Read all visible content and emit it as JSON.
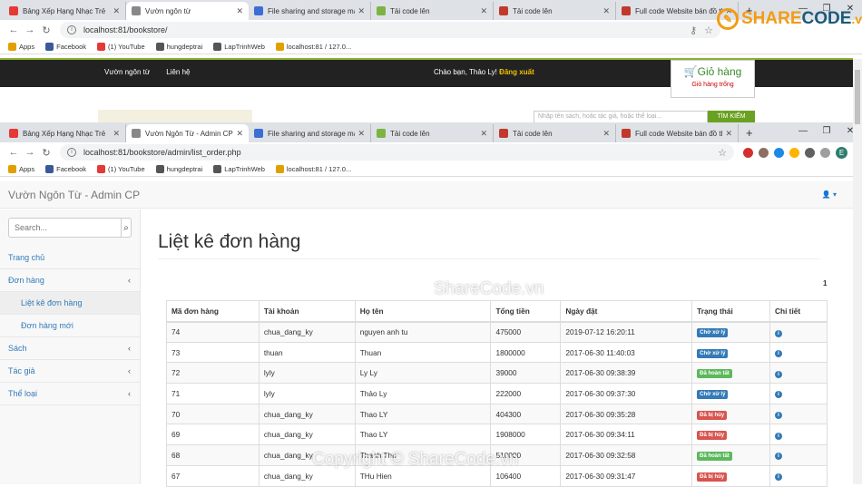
{
  "top_browser": {
    "tabs": [
      {
        "title": "Bảng Xếp Hạng Nhạc Trẻ",
        "color": "#e53935",
        "active": false
      },
      {
        "title": "Vườn ngôn từ",
        "color": "#888888",
        "active": true
      },
      {
        "title": "File sharing and storage made",
        "color": "#3b6fd6",
        "active": false
      },
      {
        "title": "Tải code lên",
        "color": "#7cb342",
        "active": false
      },
      {
        "title": "Tải code lên",
        "color": "#c0392b",
        "active": false
      },
      {
        "title": "Full code Website bán đồ thể",
        "color": "#c0392b",
        "active": false
      }
    ],
    "url": "localhost:81/bookstore/"
  },
  "bookmarks": [
    {
      "label": "Apps",
      "color": "#e0a000"
    },
    {
      "label": "Facebook",
      "color": "#3b5998"
    },
    {
      "label": "(1) YouTube",
      "color": "#e53935"
    },
    {
      "label": "hungdeptrai",
      "color": "#555555"
    },
    {
      "label": "LapTrinhWeb",
      "color": "#555555"
    },
    {
      "label": "localhost:81 / 127.0...",
      "color": "#e0a000"
    }
  ],
  "bg_site": {
    "menu": [
      "Vườn ngôn từ",
      "Liên hệ"
    ],
    "greeting": "Chào bạn, Thảo Ly!",
    "logout": "Đăng xuất",
    "cart_title": "Giỏ hàng",
    "cart_status": "Giỏ hàng trống",
    "search_placeholder": "Nhập tên sách, hoặc tác giả, hoặc thể loại...",
    "search_button": "TÌM KIẾM"
  },
  "watermark": {
    "logo_a": "SHARE",
    "logo_b": "CODE",
    "logo_c": ".vn",
    "center": "ShareCode.vn",
    "bottom": "Copyright © ShareCode.vn"
  },
  "second_browser": {
    "tabs": [
      {
        "title": "Bảng Xếp Hạng Nhạc Trẻ",
        "color": "#e53935",
        "active": false
      },
      {
        "title": "Vườn Ngôn Từ - Admin CP",
        "color": "#888888",
        "active": true
      },
      {
        "title": "File sharing and storage made",
        "color": "#3b6fd6",
        "active": false
      },
      {
        "title": "Tải code lên",
        "color": "#7cb342",
        "active": false
      },
      {
        "title": "Tải code lên",
        "color": "#c0392b",
        "active": false
      },
      {
        "title": "Full code Website bán đồ thể",
        "color": "#c0392b",
        "active": false
      }
    ],
    "url": "localhost:81/bookstore/admin/list_order.php"
  },
  "admin": {
    "brand": "Vườn Ngôn Từ - Admin CP",
    "search_placeholder": "Search...",
    "sidebar": [
      {
        "label": "Trang chủ",
        "sub": false,
        "arrow": false,
        "selected": false
      },
      {
        "label": "Đơn hàng",
        "sub": false,
        "arrow": true,
        "selected": false
      },
      {
        "label": "Liệt kê đơn hàng",
        "sub": true,
        "arrow": false,
        "selected": true
      },
      {
        "label": "Đơn hàng mới",
        "sub": true,
        "arrow": false,
        "selected": false
      },
      {
        "label": "Sách",
        "sub": false,
        "arrow": true,
        "selected": false
      },
      {
        "label": "Tác giả",
        "sub": false,
        "arrow": true,
        "selected": false
      },
      {
        "label": "Thể loại",
        "sub": false,
        "arrow": true,
        "selected": false
      }
    ],
    "page_title": "Liệt kê đơn hàng",
    "page_number": "1",
    "columns": [
      "Mã đơn hàng",
      "Tài khoản",
      "Họ tên",
      "Tổng tiền",
      "Ngày đặt",
      "Trạng thái",
      "Chi tiết"
    ],
    "rows": [
      {
        "id": "74",
        "account": "chua_dang_ky",
        "name": "nguyen anh tu",
        "total": "475000",
        "date": "2019-07-12 16:20:11",
        "status": "Chờ xử lý",
        "status_color": "blue"
      },
      {
        "id": "73",
        "account": "thuan",
        "name": "Thuan",
        "total": "1800000",
        "date": "2017-06-30 11:40:03",
        "status": "Chờ xử lý",
        "status_color": "blue"
      },
      {
        "id": "72",
        "account": "lyly",
        "name": "Ly Ly",
        "total": "39000",
        "date": "2017-06-30 09:38:39",
        "status": "Đã hoàn tất",
        "status_color": "green"
      },
      {
        "id": "71",
        "account": "lyly",
        "name": "Thảo Ly",
        "total": "222000",
        "date": "2017-06-30 09:37:30",
        "status": "Chờ xử lý",
        "status_color": "blue"
      },
      {
        "id": "70",
        "account": "chua_dang_ky",
        "name": "Thao LY",
        "total": "404300",
        "date": "2017-06-30 09:35:28",
        "status": "Đã bị hủy",
        "status_color": "red"
      },
      {
        "id": "69",
        "account": "chua_dang_ky",
        "name": "Thao LY",
        "total": "1908000",
        "date": "2017-06-30 09:34:11",
        "status": "Đã bị hủy",
        "status_color": "red"
      },
      {
        "id": "68",
        "account": "chua_dang_ky",
        "name": "Thanh Thu",
        "total": "510000",
        "date": "2017-06-30 09:32:58",
        "status": "Đã hoàn tất",
        "status_color": "green"
      },
      {
        "id": "67",
        "account": "chua_dang_ky",
        "name": "THu Hien",
        "total": "106400",
        "date": "2017-06-30 09:31:47",
        "status": "Đã bị hủy",
        "status_color": "red"
      }
    ]
  }
}
